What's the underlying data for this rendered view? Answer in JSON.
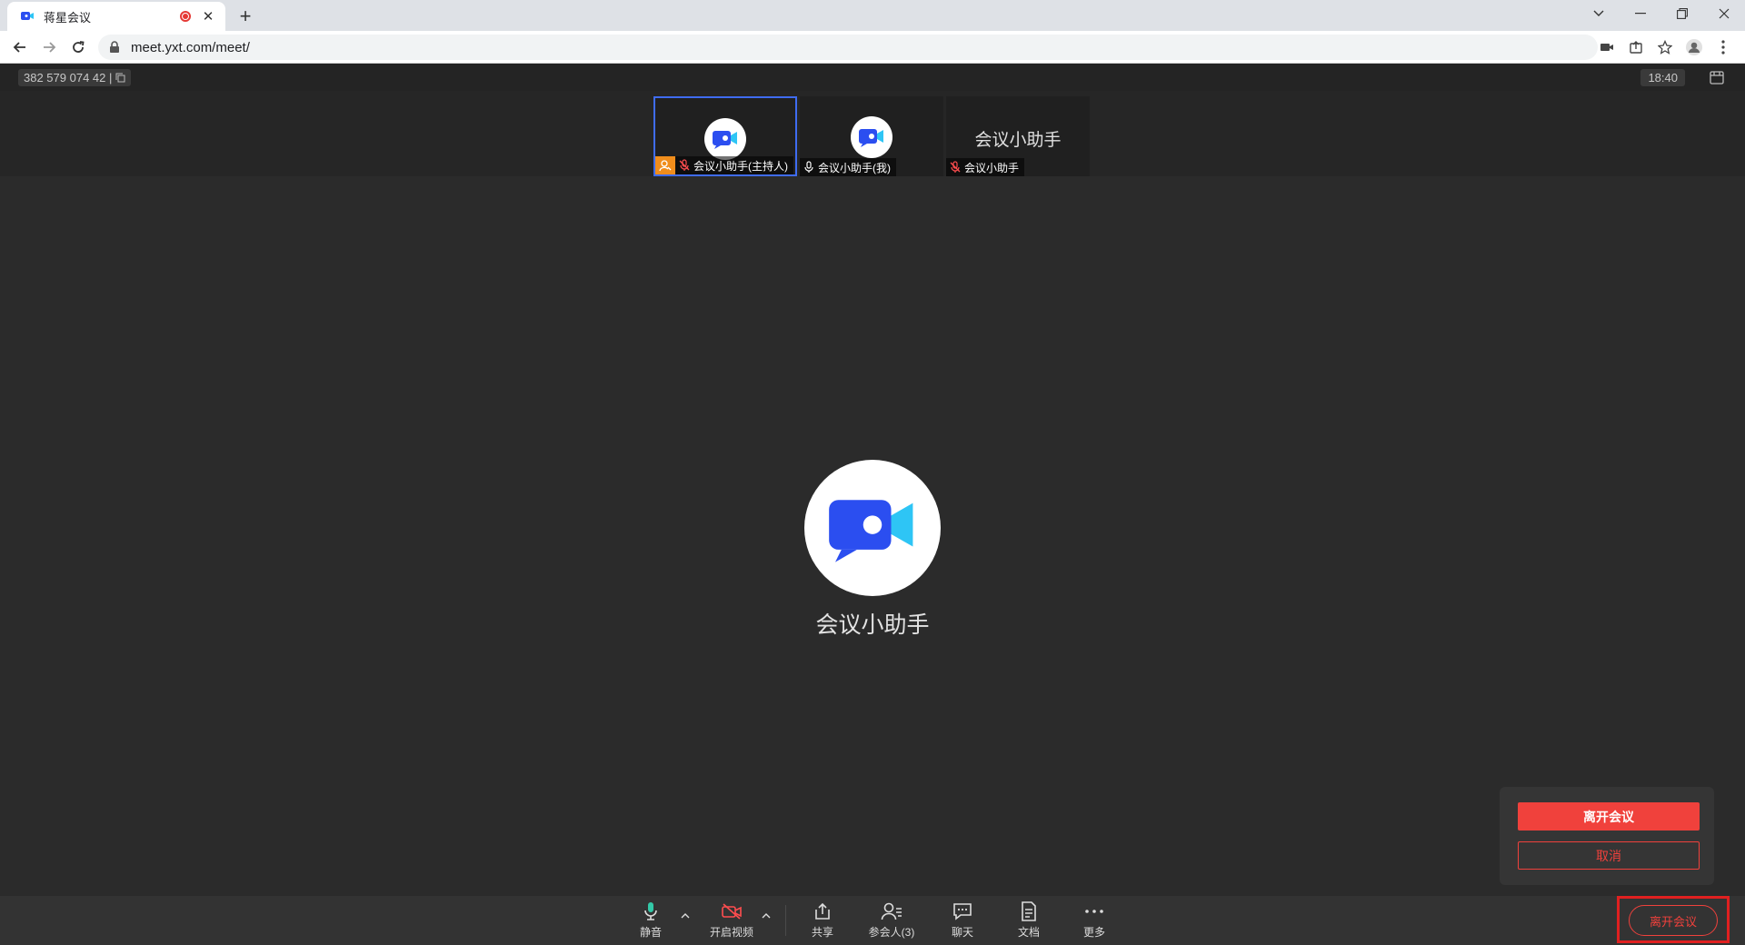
{
  "browser": {
    "tab_title": "蒋星会议",
    "url": "meet.yxt.com/meet/"
  },
  "header": {
    "meeting_id": "382 579 074 42 |",
    "time": "18:40"
  },
  "participants": [
    {
      "name": "会议小助手(主持人)",
      "host": true,
      "muted": true,
      "active": true,
      "show_avatar": true
    },
    {
      "name": "会议小助手(我)",
      "host": false,
      "muted": false,
      "active": false,
      "show_avatar": true
    },
    {
      "name": "会议小助手",
      "center_name": "会议小助手",
      "host": false,
      "muted": true,
      "active": false,
      "show_avatar": false
    }
  ],
  "stage": {
    "speaker_name": "会议小助手"
  },
  "popup": {
    "leave_label": "离开会议",
    "cancel_label": "取消"
  },
  "toolbar": {
    "mute_label": "静音",
    "video_label": "开启视频",
    "share_label": "共享",
    "participants_label": "参会人(3)",
    "chat_label": "聊天",
    "docs_label": "文档",
    "more_label": "更多",
    "leave_label": "离开会议"
  },
  "colors": {
    "accent_blue": "#3f6cf2",
    "danger_red": "#f0413c",
    "host_orange": "#f08d1c"
  }
}
